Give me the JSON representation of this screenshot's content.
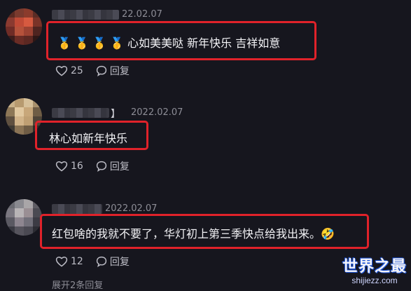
{
  "comments": [
    {
      "date": "22.02.07",
      "text": "🥇 🥇 🥇 🥇 心如美美哒 新年快乐 吉祥如意",
      "like_icon": "heart-icon",
      "likes": "25",
      "reply_icon": "reply-bubble-icon",
      "reply_label": "回复"
    },
    {
      "bracket": "】",
      "date": "2022.02.07",
      "text": "林心如新年快乐",
      "like_icon": "heart-icon",
      "likes": "16",
      "reply_icon": "reply-bubble-icon",
      "reply_label": "回复"
    },
    {
      "date": "2022.02.07",
      "text": "红包啥的我就不要了，华灯初上第三季快点给我出来。🤣",
      "like_icon": "heart-icon",
      "likes": "12",
      "reply_icon": "reply-bubble-icon",
      "reply_label": "回复"
    }
  ],
  "expand_replies": "展开2条回复",
  "watermark": {
    "title": "世界之最",
    "url": "shijiezz.com"
  },
  "colors": {
    "background": "#16161e",
    "highlight_border": "#e0222a",
    "text": "#f2f2f5",
    "secondary": "#8d8d96"
  }
}
